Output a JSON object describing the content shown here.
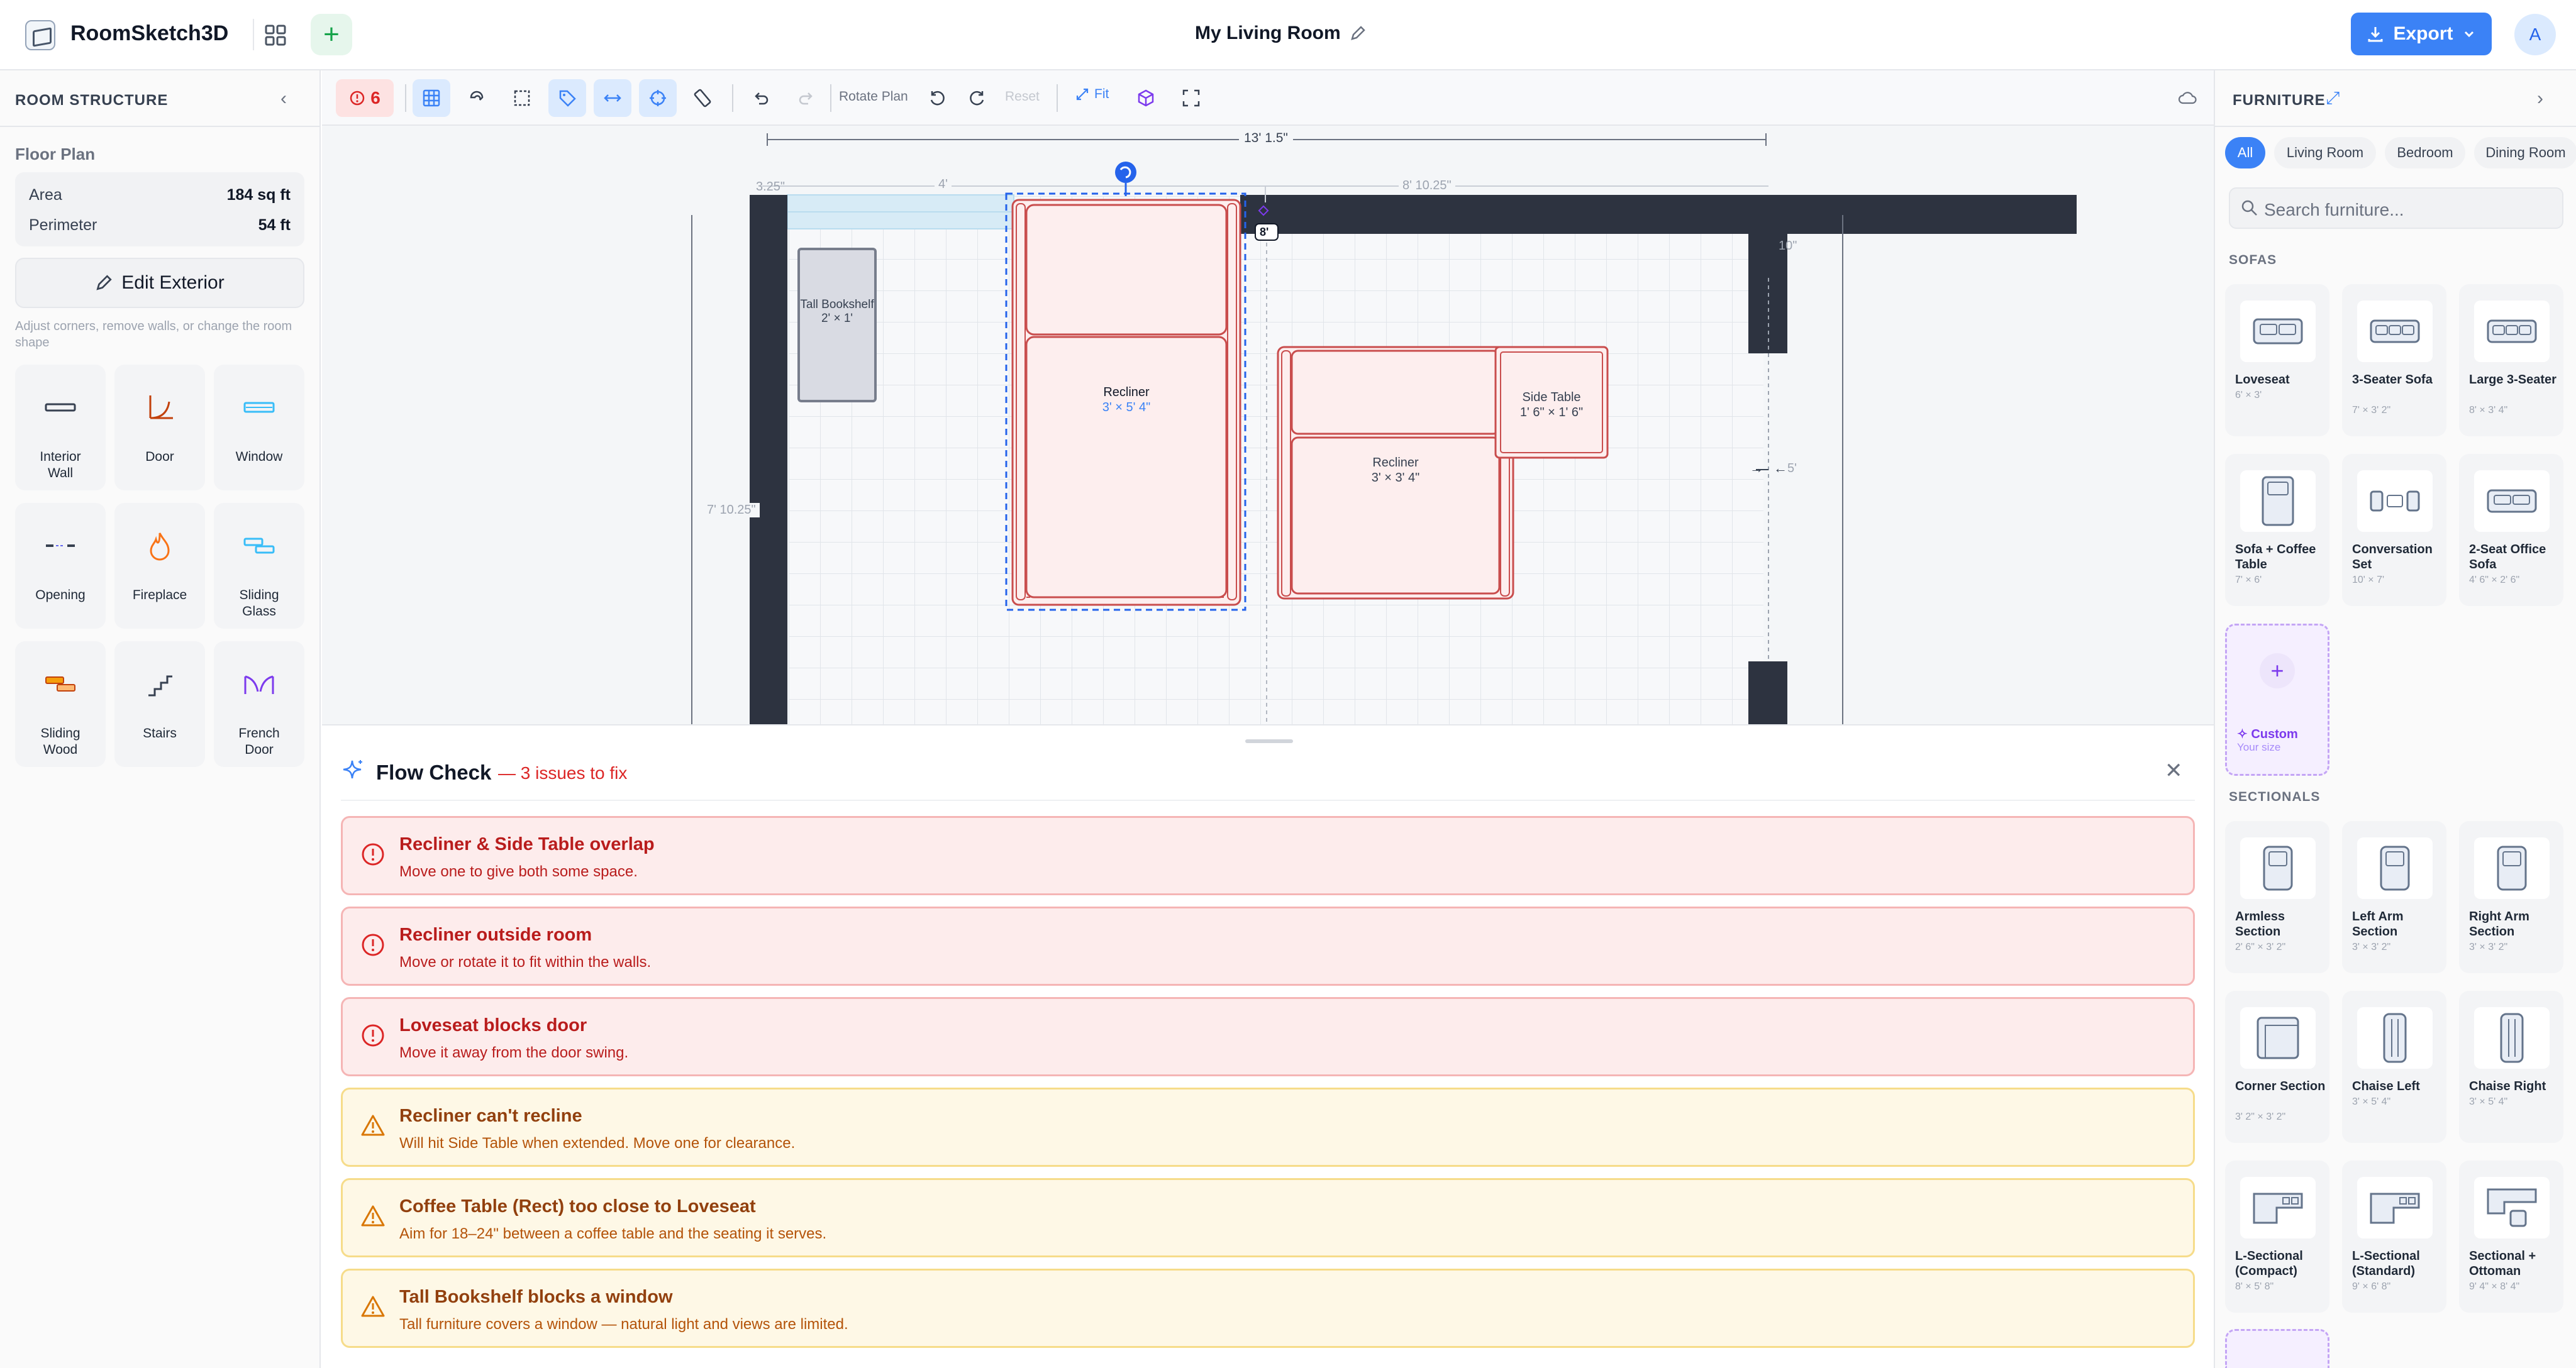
{
  "header": {
    "app_name": "RoomSketch3D",
    "doc_title": "My Living Room",
    "export_label": "Export",
    "avatar_letter": "A",
    "plus_symbol": "+"
  },
  "left_panel": {
    "title": "ROOM STRUCTURE",
    "floor_plan_label": "Floor Plan",
    "stats": [
      {
        "label": "Area",
        "value": "184 sq ft"
      },
      {
        "label": "Perimeter",
        "value": "54 ft"
      }
    ],
    "edit_exterior_label": "Edit Exterior",
    "edit_help": "Adjust corners, remove walls, or change the room shape",
    "tools": [
      {
        "label": "Interior\nWall",
        "icon": "interior-wall-icon"
      },
      {
        "label": "Door",
        "icon": "door-icon"
      },
      {
        "label": "Window",
        "icon": "window-icon"
      },
      {
        "label": "Opening",
        "icon": "opening-icon"
      },
      {
        "label": "Fireplace",
        "icon": "fireplace-icon"
      },
      {
        "label": "Sliding\nGlass",
        "icon": "sliding-glass-icon"
      },
      {
        "label": "Sliding\nWood",
        "icon": "sliding-wood-icon"
      },
      {
        "label": "Stairs",
        "icon": "stairs-icon"
      },
      {
        "label": "French\nDoor",
        "icon": "french-door-icon"
      }
    ]
  },
  "toolbar": {
    "alert_count": "6",
    "rotate_plan_label": "Rotate Plan",
    "reset_label": "Reset",
    "fit_label": "Fit"
  },
  "canvas": {
    "dimensions": {
      "top_total": "13' 1.5\"",
      "seg_left": "3.25\"",
      "seg_window": "4'",
      "seg_right": "8' 10.25\"",
      "right_top": "10\"",
      "right_mid": "5'",
      "left_mid": "7' 10.25\"",
      "marker": "8'"
    },
    "items": [
      {
        "name": "Tall Bookshelf",
        "size": "2' × 1'"
      },
      {
        "name": "Recliner",
        "size": "3' × 5' 4\""
      },
      {
        "name": "Recliner",
        "size": "3' × 3' 4\""
      },
      {
        "name": "Side Table",
        "size": "1' 6\" × 1' 6\""
      }
    ]
  },
  "flow_check": {
    "title": "Flow Check",
    "subtitle": "— 3 issues to fix",
    "issues": [
      {
        "level": "error",
        "title": "Recliner & Side Table overlap",
        "desc": "Move one to give both some space."
      },
      {
        "level": "error",
        "title": "Recliner outside room",
        "desc": "Move or rotate it to fit within the walls."
      },
      {
        "level": "error",
        "title": "Loveseat blocks door",
        "desc": "Move it away from the door swing."
      },
      {
        "level": "warning",
        "title": "Recliner can't recline",
        "desc": "Will hit Side Table when extended. Move one for clearance."
      },
      {
        "level": "warning",
        "title": "Coffee Table (Rect) too close to Loveseat",
        "desc": "Aim for 18–24\" between a coffee table and the seating it serves."
      },
      {
        "level": "warning",
        "title": "Tall Bookshelf blocks a window",
        "desc": "Tall furniture covers a window — natural light and views are limited."
      }
    ]
  },
  "right_panel": {
    "title": "FURNITURE",
    "filters": [
      "All",
      "Living Room",
      "Bedroom",
      "Dining Room"
    ],
    "search_placeholder": "Search furniture...",
    "sofas_label": "SOFAS",
    "sofas": [
      {
        "name": "Loveseat",
        "size": "6' × 3'"
      },
      {
        "name": "3-Seater Sofa",
        "size": "7' × 3' 2\""
      },
      {
        "name": "Large 3-Seater",
        "size": "8' × 3' 4\""
      },
      {
        "name": "Sofa + Coffee Table",
        "size": "7' × 6'"
      },
      {
        "name": "Conversation Set",
        "size": "10' × 7'"
      },
      {
        "name": "2-Seat Office Sofa",
        "size": "4' 6\" × 2' 6\""
      }
    ],
    "custom_label": "Custom",
    "custom_sub": "Your size",
    "sectionals_label": "SECTIONALS",
    "sectionals": [
      {
        "name": "Armless Section",
        "size": "2' 6\" × 3' 2\""
      },
      {
        "name": "Left Arm Section",
        "size": "3' × 3' 2\""
      },
      {
        "name": "Right Arm Section",
        "size": "3' × 3' 2\""
      },
      {
        "name": "Corner Section",
        "size": "3' 2\" × 3' 2\""
      },
      {
        "name": "Chaise Left",
        "size": "3' × 5' 4\""
      },
      {
        "name": "Chaise Right",
        "size": "3' × 5' 4\""
      },
      {
        "name": "L-Sectional (Compact)",
        "size": "8' × 5' 8\""
      },
      {
        "name": "L-Sectional (Standard)",
        "size": "9' × 6' 8\""
      },
      {
        "name": "Sectional + Ottoman",
        "size": "9' 4\" × 8' 4\""
      }
    ]
  },
  "colors": {
    "accent": "#3b82f6",
    "error": "#dc2626",
    "warning": "#b45309",
    "wall": "#2d3340",
    "furniture_overlap": "#ef4444"
  }
}
